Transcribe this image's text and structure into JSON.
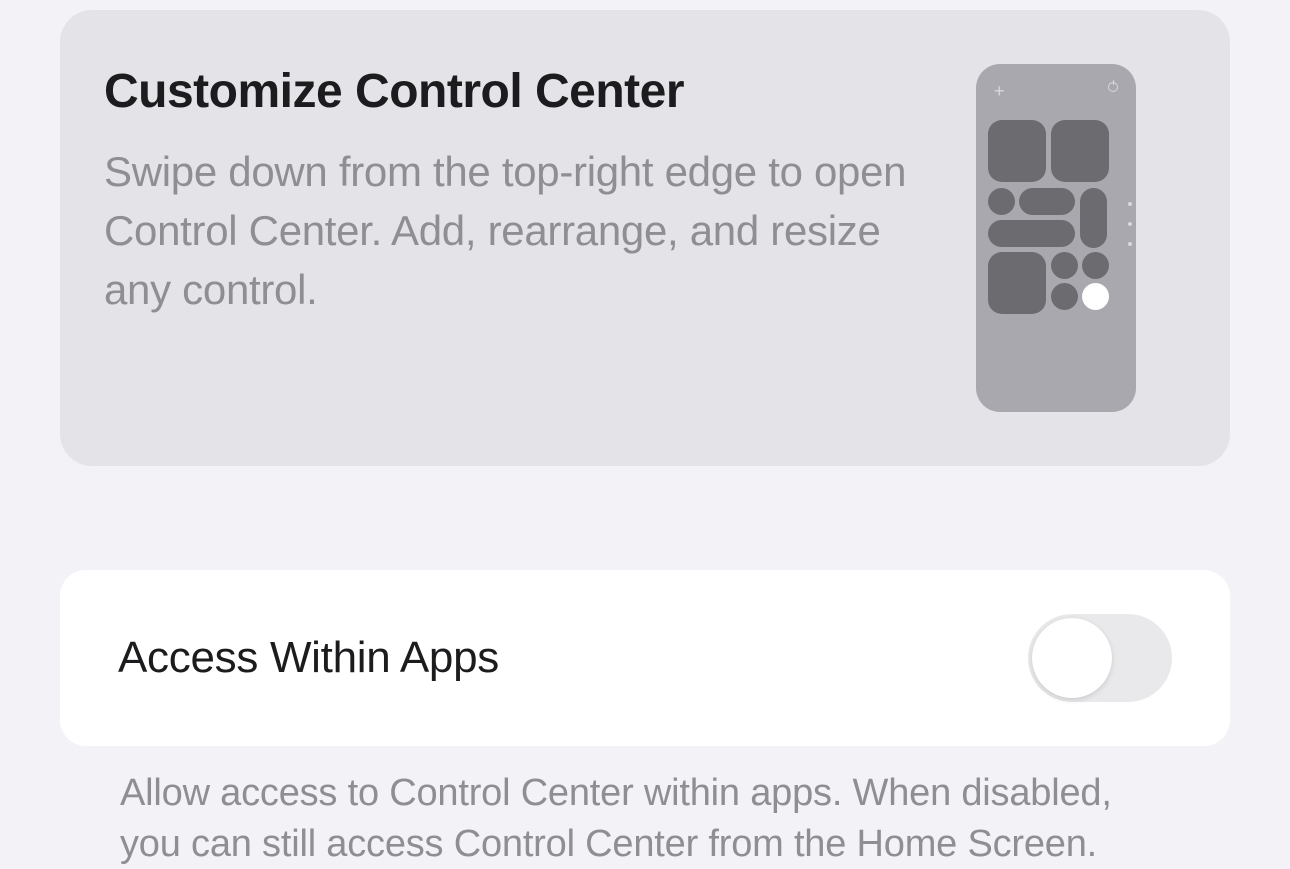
{
  "hero": {
    "title": "Customize Control Center",
    "description": "Swipe down from the top-right edge to open Control Center. Add, rearrange, and resize any control."
  },
  "settings": {
    "access_within_apps": {
      "label": "Access Within Apps",
      "enabled": false,
      "footer": "Allow access to Control Center within apps. When disabled, you can still access Control Center from the Home Screen."
    }
  }
}
